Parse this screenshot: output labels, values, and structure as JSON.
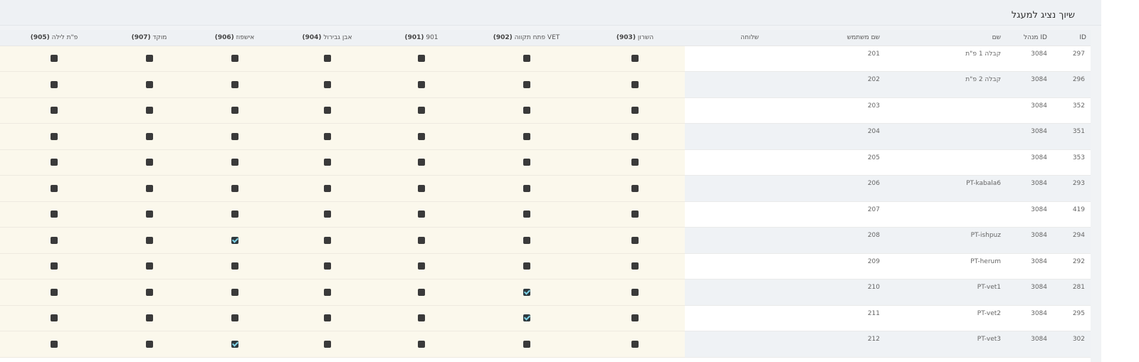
{
  "title": "שיוך נציג למעגל",
  "columns": {
    "id": "ID",
    "manager_id": "ID מנהל",
    "name": "שם",
    "username": "שם משתמש",
    "extension": "שלוחה",
    "perm": [
      {
        "name": "השרון",
        "code": "(903)"
      },
      {
        "name": "VET פתח תקווה",
        "code": "(902)"
      },
      {
        "name": "901",
        "code": "(901)"
      },
      {
        "name": "אבן גבירול",
        "code": "(904)"
      },
      {
        "name": "אישפוז",
        "code": "(906)"
      },
      {
        "name": "מוקד",
        "code": "(907)"
      },
      {
        "name": "פ\"ת לילה",
        "code": "(905)"
      }
    ]
  },
  "rows": [
    {
      "id": "297",
      "manager_id": "3084",
      "name": "קבלה 1 פ\"ת",
      "username": "201",
      "checks": [
        false,
        false,
        false,
        false,
        false,
        false,
        false
      ]
    },
    {
      "id": "296",
      "manager_id": "3084",
      "name": "קבלה 2 פ\"ת",
      "username": "202",
      "checks": [
        false,
        false,
        false,
        false,
        false,
        false,
        false
      ]
    },
    {
      "id": "352",
      "manager_id": "3084",
      "name": "",
      "username": "203",
      "checks": [
        false,
        false,
        false,
        false,
        false,
        false,
        false
      ]
    },
    {
      "id": "351",
      "manager_id": "3084",
      "name": "",
      "username": "204",
      "checks": [
        false,
        false,
        false,
        false,
        false,
        false,
        false
      ]
    },
    {
      "id": "353",
      "manager_id": "3084",
      "name": "",
      "username": "205",
      "checks": [
        false,
        false,
        false,
        false,
        false,
        false,
        false
      ]
    },
    {
      "id": "293",
      "manager_id": "3084",
      "name": "PT-kabala6",
      "username": "206",
      "checks": [
        false,
        false,
        false,
        false,
        false,
        false,
        false
      ]
    },
    {
      "id": "419",
      "manager_id": "3084",
      "name": "",
      "username": "207",
      "checks": [
        false,
        false,
        false,
        false,
        false,
        false,
        false
      ]
    },
    {
      "id": "294",
      "manager_id": "3084",
      "name": "PT-ishpuz",
      "username": "208",
      "checks": [
        false,
        false,
        false,
        false,
        true,
        false,
        false
      ]
    },
    {
      "id": "292",
      "manager_id": "3084",
      "name": "PT-herum",
      "username": "209",
      "checks": [
        false,
        false,
        false,
        false,
        false,
        false,
        false
      ]
    },
    {
      "id": "281",
      "manager_id": "3084",
      "name": "PT-vet1",
      "username": "210",
      "checks": [
        false,
        true,
        false,
        false,
        false,
        false,
        false
      ]
    },
    {
      "id": "295",
      "manager_id": "3084",
      "name": "PT-vet2",
      "username": "211",
      "checks": [
        false,
        true,
        false,
        false,
        false,
        false,
        false
      ]
    },
    {
      "id": "302",
      "manager_id": "3084",
      "name": "PT-vet3",
      "username": "212",
      "checks": [
        false,
        false,
        false,
        false,
        true,
        false,
        false
      ]
    }
  ]
}
